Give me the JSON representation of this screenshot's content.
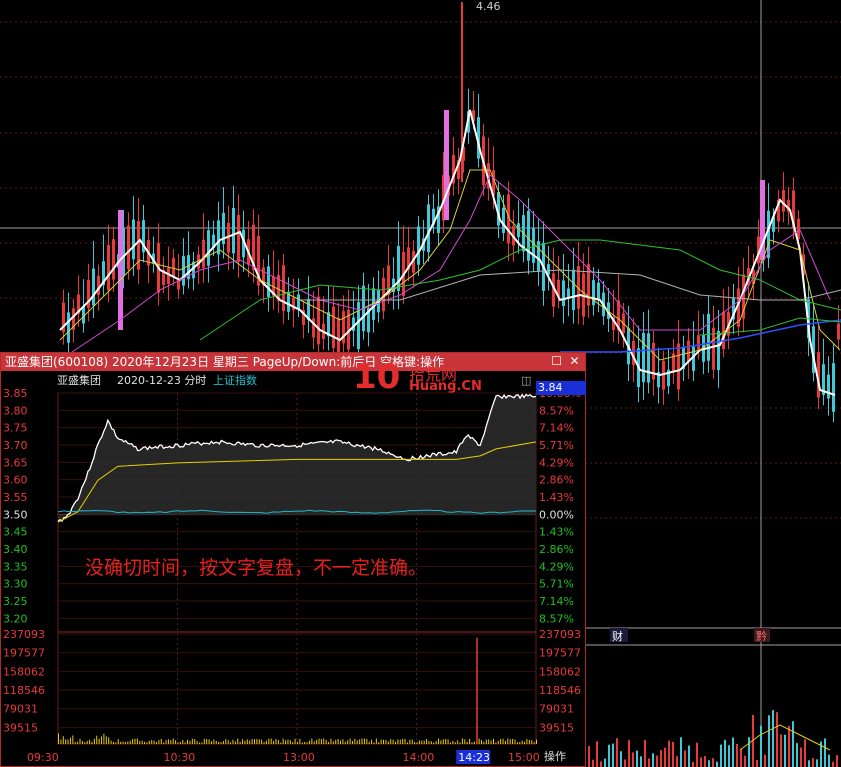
{
  "background_chart": {
    "peak_label": "4.46",
    "markers": [
      "财",
      "黔"
    ]
  },
  "window": {
    "title": "亚盛集团(600108) 2020年12月23日 星期三 PageUp/Down:前后日 空格键:操作",
    "restore_icon": "restore-icon",
    "close_icon": "close-icon"
  },
  "subbar": {
    "name": "亚盛集团",
    "date_mode": "2020-12-23 分时",
    "index_link": "上证指数"
  },
  "logo": {
    "big": "10",
    "cn": "拾荒网",
    "en": "Huang.CN"
  },
  "note": "没确切时间，按文字复盘，不一定准确。",
  "current_price": "3.84",
  "op_label": "操作",
  "highlight_time": "14:23",
  "colors": {
    "up": "#e83a3a",
    "down": "#20c020",
    "price_line": "#ffffff",
    "avg_line": "#e6d000",
    "index_line": "#20b8c8",
    "volume": "#e6d000"
  },
  "chart_data": {
    "type": "line",
    "price_axis": [
      "3.85",
      "3.80",
      "3.75",
      "3.70",
      "3.65",
      "3.60",
      "3.55",
      "3.50",
      "3.45",
      "3.40",
      "3.35",
      "3.30",
      "3.25",
      "3.20"
    ],
    "pct_axis": [
      "10.00%",
      "8.57%",
      "7.14%",
      "5.71%",
      "4.29%",
      "2.86%",
      "1.43%",
      "0.00%",
      "1.43%",
      "2.86%",
      "4.29%",
      "5.71%",
      "7.14%",
      "8.57%"
    ],
    "volume_axis": [
      "237093",
      "197577",
      "158062",
      "118546",
      "79031",
      "39515"
    ],
    "time_labels": [
      "09:30",
      "10:30",
      "13:00",
      "14:00",
      "15:00"
    ],
    "price_ylim": [
      3.18,
      3.85
    ],
    "price": [
      {
        "t": 0,
        "v": 3.48
      },
      {
        "t": 5,
        "v": 3.5
      },
      {
        "t": 10,
        "v": 3.55
      },
      {
        "t": 15,
        "v": 3.62
      },
      {
        "t": 20,
        "v": 3.7
      },
      {
        "t": 25,
        "v": 3.77
      },
      {
        "t": 30,
        "v": 3.72
      },
      {
        "t": 40,
        "v": 3.69
      },
      {
        "t": 60,
        "v": 3.7
      },
      {
        "t": 80,
        "v": 3.71
      },
      {
        "t": 100,
        "v": 3.7
      },
      {
        "t": 120,
        "v": 3.7
      },
      {
        "t": 140,
        "v": 3.71
      },
      {
        "t": 160,
        "v": 3.69
      },
      {
        "t": 175,
        "v": 3.66
      },
      {
        "t": 185,
        "v": 3.67
      },
      {
        "t": 200,
        "v": 3.68
      },
      {
        "t": 205,
        "v": 3.73
      },
      {
        "t": 212,
        "v": 3.7
      },
      {
        "t": 220,
        "v": 3.84
      },
      {
        "t": 240,
        "v": 3.84
      }
    ],
    "avg": [
      {
        "t": 0,
        "v": 3.48
      },
      {
        "t": 10,
        "v": 3.51
      },
      {
        "t": 20,
        "v": 3.6
      },
      {
        "t": 30,
        "v": 3.64
      },
      {
        "t": 60,
        "v": 3.65
      },
      {
        "t": 120,
        "v": 3.66
      },
      {
        "t": 200,
        "v": 3.66
      },
      {
        "t": 212,
        "v": 3.67
      },
      {
        "t": 220,
        "v": 3.69
      },
      {
        "t": 240,
        "v": 3.71
      }
    ],
    "index": [
      {
        "t": 0,
        "v": 3.51
      },
      {
        "t": 30,
        "v": 3.5
      },
      {
        "t": 60,
        "v": 3.51
      },
      {
        "t": 90,
        "v": 3.52
      },
      {
        "t": 120,
        "v": 3.51
      },
      {
        "t": 150,
        "v": 3.5
      },
      {
        "t": 180,
        "v": 3.51
      },
      {
        "t": 210,
        "v": 3.5
      },
      {
        "t": 240,
        "v": 3.51
      }
    ],
    "volume_ylim": [
      0,
      237093
    ],
    "volume_spike": {
      "t": 210,
      "v": 225000
    }
  }
}
